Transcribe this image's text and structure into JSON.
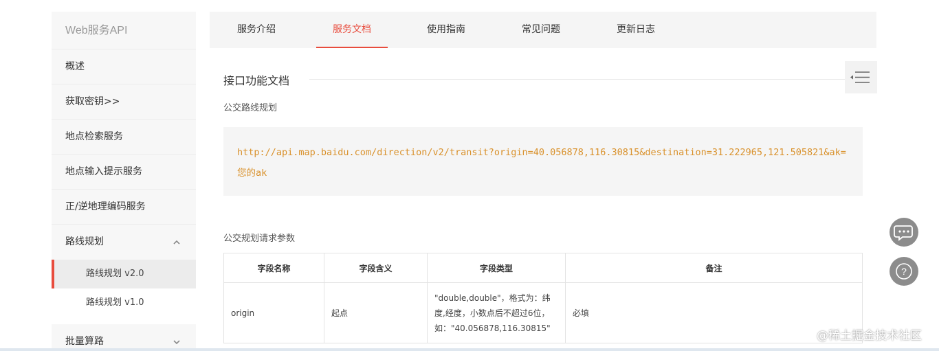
{
  "sidebar": {
    "title": "Web服务API",
    "items": [
      {
        "label": "概述"
      },
      {
        "label": "获取密钥>>"
      },
      {
        "label": "地点检索服务"
      },
      {
        "label": "地点输入提示服务"
      },
      {
        "label": "正/逆地理编码服务"
      },
      {
        "label": "路线规划",
        "expanded": true
      },
      {
        "label": "批量算路",
        "expanded": false
      }
    ],
    "sub_items": [
      {
        "label": "路线规划 v2.0",
        "active": true
      },
      {
        "label": "路线规划 v1.0",
        "active": false
      }
    ]
  },
  "tabs": [
    {
      "label": "服务介绍",
      "active": false
    },
    {
      "label": "服务文档",
      "active": true
    },
    {
      "label": "使用指南",
      "active": false
    },
    {
      "label": "常见问题",
      "active": false
    },
    {
      "label": "更新日志",
      "active": false
    }
  ],
  "content": {
    "section_title": "接口功能文档",
    "sub_title": "公交路线规划",
    "code": "http://api.map.baidu.com/direction/v2/transit?origin=40.056878,116.30815&destination=31.222965,121.505821&ak=您的ak",
    "params_title": "公交规划请求参数",
    "table": {
      "headers": [
        "字段名称",
        "字段含义",
        "字段类型",
        "备注"
      ],
      "rows": [
        {
          "name": "origin",
          "meaning": "起点",
          "type": "\"double,double\"，格式为：纬度,经度，小数点后不超过6位，如：\"40.056878,116.30815\"",
          "note": "必填"
        }
      ]
    }
  },
  "float_buttons": [
    {
      "icon": "chat-icon"
    },
    {
      "icon": "help-icon"
    }
  ],
  "watermark": "@稀土掘金技术社区",
  "colors": {
    "accent": "#e84c3d",
    "code_text": "#d9912b",
    "sidebar_bg": "#f7f7f7",
    "float_button": "#8c8c8c"
  }
}
